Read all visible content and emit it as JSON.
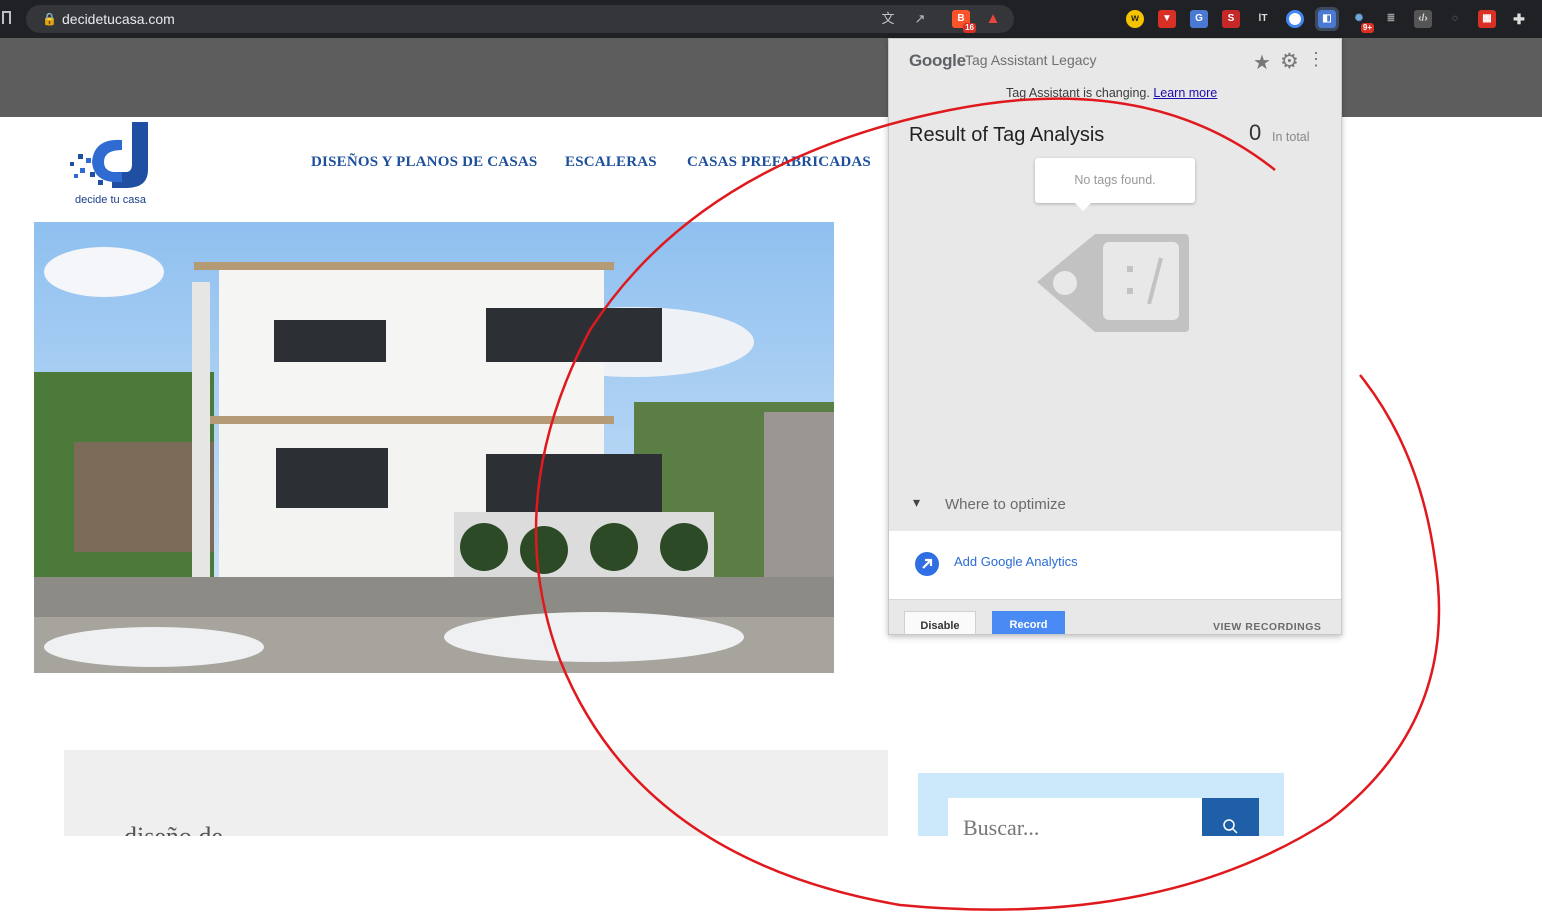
{
  "browser": {
    "url": "decidetucasa.com",
    "extension_badges": {
      "brave": "16",
      "notifications": "9+"
    }
  },
  "site": {
    "logo_tagline": "decide tu casa",
    "nav": [
      {
        "label": "DISEÑOS Y PLANOS DE CASAS"
      },
      {
        "label": "ESCALERAS"
      },
      {
        "label": "CASAS PREFABRICADAS"
      }
    ],
    "search_placeholder": "Buscar..."
  },
  "popup": {
    "brand": "Google",
    "title": "Tag Assistant Legacy",
    "changing_text": "Tag Assistant is changing.",
    "learn_more": "Learn more",
    "result_title": "Result of Tag Analysis",
    "count": "0",
    "count_label": "In total",
    "no_tags": "No tags found.",
    "where_to_optimize": "Where to optimize",
    "add_ga": "Add Google Analytics",
    "disable_label": "Disable",
    "record_label": "Record",
    "view_recordings": "VIEW RECORDINGS"
  },
  "colors": {
    "nav_blue": "#1c4f9c",
    "record_blue": "#4a8af4",
    "annotation_red": "#e0191e"
  }
}
